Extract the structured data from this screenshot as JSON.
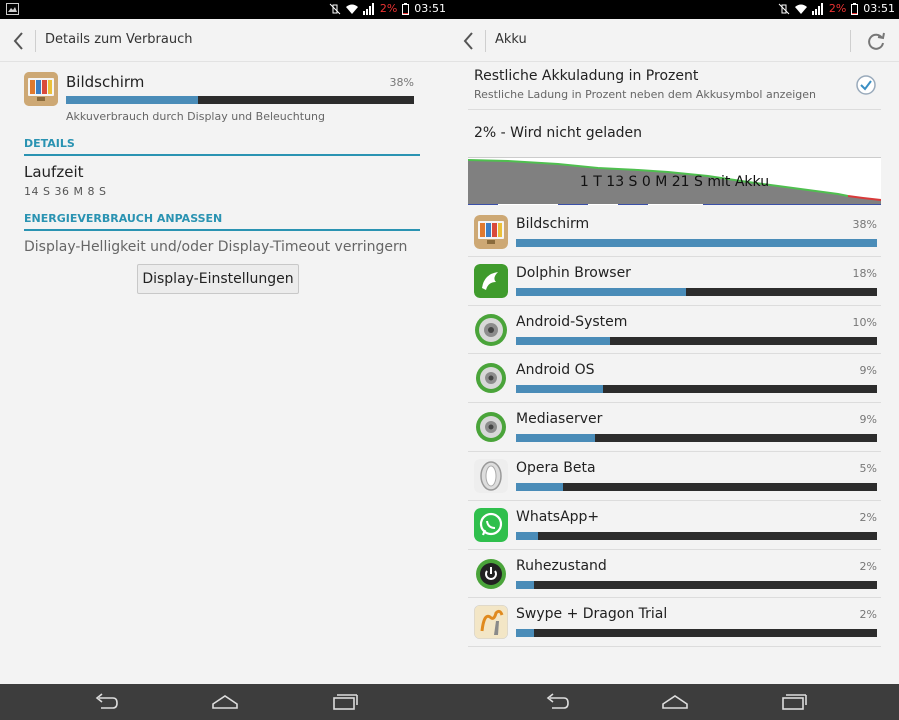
{
  "left": {
    "status": {
      "battery_pct": "2%",
      "time": "03:51"
    },
    "title": "Details zum Verbrauch",
    "app": {
      "name": "Bildschirm",
      "percent": "38%",
      "fraction": 0.38,
      "description": "Akkuverbrauch durch Display und Beleuchtung"
    },
    "details_header": "DETAILS",
    "runtime": {
      "label": "Laufzeit",
      "value": "14 S 36 M 8 S"
    },
    "adjust_header": "ENERGIEVERBRAUCH ANPASSEN",
    "hint": "Display-Helligkeit und/oder Display-Timeout verringern",
    "button": "Display-Einstellungen"
  },
  "right": {
    "status": {
      "battery_pct": "2%",
      "time": "03:51"
    },
    "title": "Akku",
    "pref": {
      "title": "Restliche Akkuladung in Prozent",
      "subtitle": "Restliche Ladung in Prozent neben dem Akkusymbol anzeigen",
      "checked": true
    },
    "battery_status": "2% - Wird nicht geladen",
    "graph_label": "1 T 13 S 0 M 21 S mit Akku",
    "items": [
      {
        "name": "Bildschirm",
        "percent": "38%",
        "fraction": 1.0,
        "icon": "screen-icon"
      },
      {
        "name": "Dolphin Browser",
        "percent": "18%",
        "fraction": 0.47,
        "icon": "dolphin-icon"
      },
      {
        "name": "Android-System",
        "percent": "10%",
        "fraction": 0.26,
        "icon": "android-system-icon"
      },
      {
        "name": "Android OS",
        "percent": "9%",
        "fraction": 0.24,
        "icon": "android-os-icon"
      },
      {
        "name": "Mediaserver",
        "percent": "9%",
        "fraction": 0.22,
        "icon": "mediaserver-icon"
      },
      {
        "name": "Opera Beta",
        "percent": "5%",
        "fraction": 0.13,
        "icon": "opera-icon"
      },
      {
        "name": "WhatsApp+",
        "percent": "2%",
        "fraction": 0.06,
        "icon": "whatsapp-icon"
      },
      {
        "name": "Ruhezustand",
        "percent": "2%",
        "fraction": 0.05,
        "icon": "power-icon"
      },
      {
        "name": "Swype + Dragon Trial",
        "percent": "2%",
        "fraction": 0.05,
        "icon": "swype-icon"
      }
    ]
  },
  "colors": {
    "accent": "#2a93b2",
    "bar_fill": "#4a8cb8",
    "bar_track": "#2c2c2c",
    "battery_low": "#e33333"
  }
}
